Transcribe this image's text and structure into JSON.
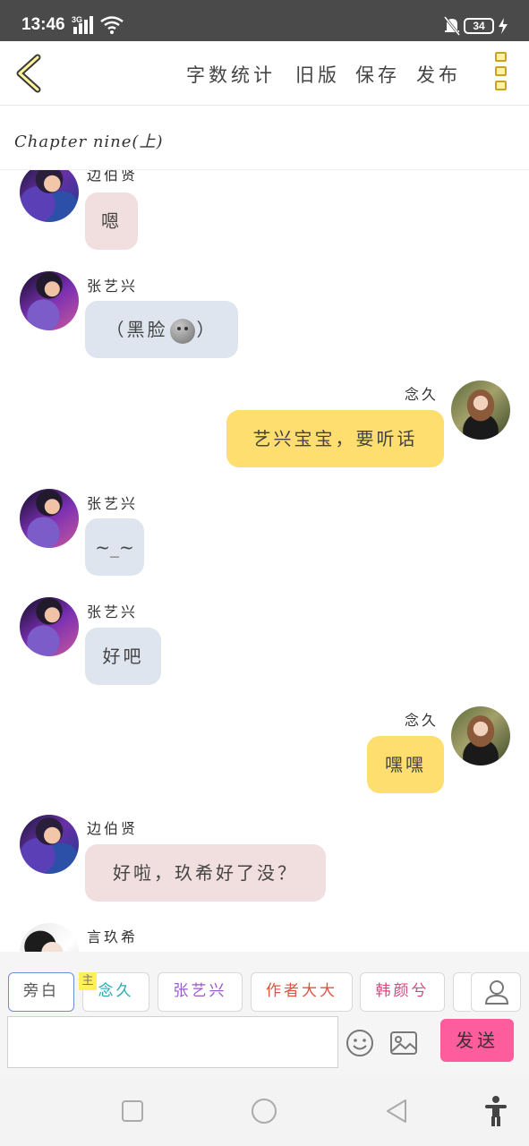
{
  "status": {
    "time": "13:46",
    "network": "3G",
    "battery": "34"
  },
  "header": {
    "word_count": "字数统计",
    "old_version": "旧版",
    "save": "保存",
    "publish": "发布"
  },
  "chapter": {
    "title": "Chapter nine(上)"
  },
  "messages": [
    {
      "sender": "边伯贤",
      "text": "嗯",
      "side": "left",
      "color": "#f1dede",
      "avatar": "boy"
    },
    {
      "sender": "张艺兴",
      "text": "（黑脸",
      "text_after": "）",
      "side": "left",
      "color": "#dfe5ee",
      "avatar": "boy2"
    },
    {
      "sender": "念久",
      "text": "艺兴宝宝，要听话",
      "side": "right",
      "color": "#fede6f",
      "avatar": "girl"
    },
    {
      "sender": "张艺兴",
      "text": "~_~",
      "side": "left",
      "color": "#dfe5ee",
      "avatar": "boy2"
    },
    {
      "sender": "张艺兴",
      "text": "好吧",
      "side": "left",
      "color": "#dfe5ee",
      "avatar": "boy2"
    },
    {
      "sender": "念久",
      "text": "嘿嘿",
      "side": "right",
      "color": "#fede6f",
      "avatar": "girl"
    },
    {
      "sender": "边伯贤",
      "text": "好啦，玖希好了没？",
      "side": "left",
      "color": "#f1dede",
      "avatar": "boy"
    },
    {
      "sender": "言玖希",
      "text": "",
      "side": "left",
      "color": "#ffffff",
      "avatar": "girl2"
    }
  ],
  "roles": [
    {
      "label": "旁白",
      "color": "#555555"
    },
    {
      "label": "念久",
      "color": "#27a9b4"
    },
    {
      "label": "张艺兴",
      "color": "#9b59c9"
    },
    {
      "label": "作者大大",
      "color": "#e0533f"
    },
    {
      "label": "韩颜兮",
      "color": "#d6477f"
    }
  ],
  "main_badge": "主",
  "composer": {
    "send_label": "发送"
  }
}
